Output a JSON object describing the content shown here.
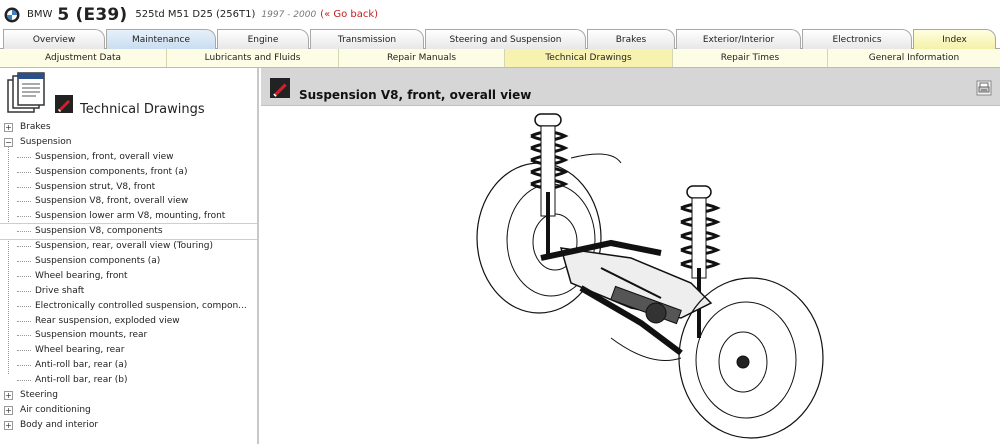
{
  "header": {
    "make": "BMW",
    "model": "5 (E39)",
    "engine": "525td M51 D25 (256T1)",
    "years": "1997 - 2000",
    "back_link": "(« Go back)"
  },
  "tabs": [
    {
      "label": "Overview"
    },
    {
      "label": "Maintenance"
    },
    {
      "label": "Engine"
    },
    {
      "label": "Transmission"
    },
    {
      "label": "Steering and Suspension"
    },
    {
      "label": "Brakes"
    },
    {
      "label": "Exterior/Interior"
    },
    {
      "label": "Electronics"
    },
    {
      "label": "Index"
    }
  ],
  "subtabs": [
    {
      "label": "Adjustment Data"
    },
    {
      "label": "Lubricants and Fluids"
    },
    {
      "label": "Repair Manuals"
    },
    {
      "label": "Technical Drawings"
    },
    {
      "label": "Repair Times"
    },
    {
      "label": "General Information"
    }
  ],
  "active_subtab": "Technical Drawings",
  "sidebar": {
    "title": "Technical Drawings",
    "tree": [
      {
        "label": "Brakes",
        "expander": "+"
      },
      {
        "label": "Suspension",
        "expander": "−"
      },
      {
        "label": "Suspension, front, overall view"
      },
      {
        "label": "Suspension components, front (a)"
      },
      {
        "label": "Suspension strut, V8, front"
      },
      {
        "label": "Suspension V8, front, overall view"
      },
      {
        "label": "Suspension lower arm V8, mounting, front"
      },
      {
        "label": "Suspension V8, components"
      },
      {
        "label": "Suspension, rear, overall view (Touring)"
      },
      {
        "label": "Suspension components (a)"
      },
      {
        "label": "Wheel bearing, front"
      },
      {
        "label": "Drive shaft"
      },
      {
        "label": "Electronically controlled suspension, compon..."
      },
      {
        "label": "Rear suspension, exploded view"
      },
      {
        "label": "Suspension mounts, rear"
      },
      {
        "label": "Wheel bearing, rear"
      },
      {
        "label": "Anti-roll bar, rear (a)"
      },
      {
        "label": "Anti-roll bar, rear (b)"
      },
      {
        "label": "Steering",
        "expander": "+"
      },
      {
        "label": "Air conditioning",
        "expander": "+"
      },
      {
        "label": "Body and interior",
        "expander": "+"
      }
    ]
  },
  "main": {
    "title": "Suspension V8, front, overall view"
  },
  "colors": {
    "back_link": "#c02020",
    "active_subtab": "#f7f2b0",
    "maintenance_tab": "#c9def0",
    "index_tab": "#f5f0a8",
    "panel_header": "#d6d6d6"
  }
}
